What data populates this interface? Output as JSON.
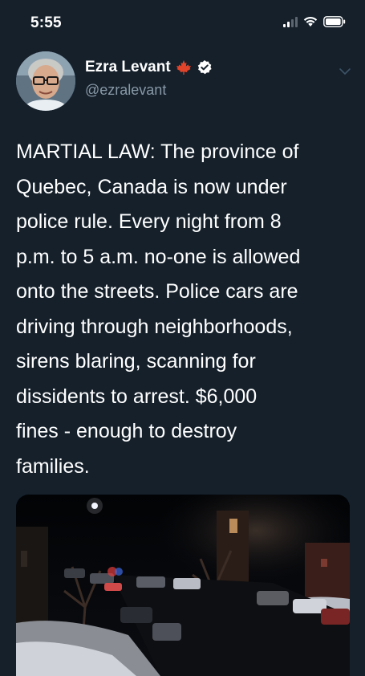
{
  "status_bar": {
    "time": "5:55",
    "icons": [
      "signal-icon",
      "wifi-icon",
      "battery-icon"
    ]
  },
  "tweet": {
    "author_name": "Ezra Levant",
    "author_handle": "@ezralevant",
    "badges": [
      "maple-leaf-icon",
      "verified-badge-icon"
    ],
    "menu_icon": "chevron-down-icon",
    "text": "MARTIAL LAW: The province of\nQuebec, Canada is now under\npolice rule. Every night from 8\np.m. to 5 a.m. no-one is allowed\nonto the streets. Police cars are\ndriving through neighborhoods,\nsirens blaring, scanning for\ndissidents to arrest. $6,000\nfines - enough to destroy\nfamilies.",
    "media": {
      "type": "photo",
      "subject": "night-street-photo"
    }
  },
  "colors": {
    "background": "#15202b",
    "text_primary": "#ffffff",
    "text_secondary": "#8899a6",
    "verified_badge": "#ffffff",
    "maple_leaf": "#e0442a"
  }
}
